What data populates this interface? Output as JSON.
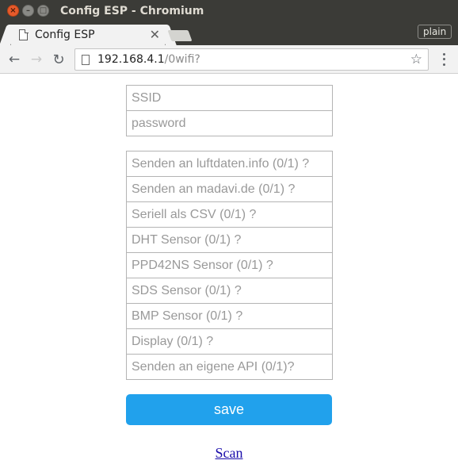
{
  "window": {
    "title": "Config ESP - Chromium",
    "plain_badge": "plain"
  },
  "tabs": [
    {
      "title": "Config ESP",
      "close_icon": "close-icon"
    }
  ],
  "toolbar": {
    "url_host": "192.168.4.1",
    "url_path": "/0wifi?"
  },
  "form": {
    "credentials": [
      {
        "placeholder": "SSID"
      },
      {
        "placeholder": "password"
      }
    ],
    "options": [
      {
        "placeholder": "Senden an luftdaten.info (0/1) ?"
      },
      {
        "placeholder": "Senden an madavi.de (0/1) ?"
      },
      {
        "placeholder": "Seriell als CSV (0/1) ?"
      },
      {
        "placeholder": "DHT Sensor (0/1) ?"
      },
      {
        "placeholder": "PPD42NS Sensor (0/1) ?"
      },
      {
        "placeholder": "SDS Sensor (0/1) ?"
      },
      {
        "placeholder": "BMP Sensor (0/1) ?"
      },
      {
        "placeholder": "Display (0/1) ?"
      },
      {
        "placeholder": "Senden an eigene API (0/1)?"
      }
    ],
    "save_label": "save",
    "scan_link": "Scan",
    "colors": {
      "save_button": "#21a1ec",
      "placeholder_text": "#999999",
      "link": "#1a0dab"
    }
  }
}
